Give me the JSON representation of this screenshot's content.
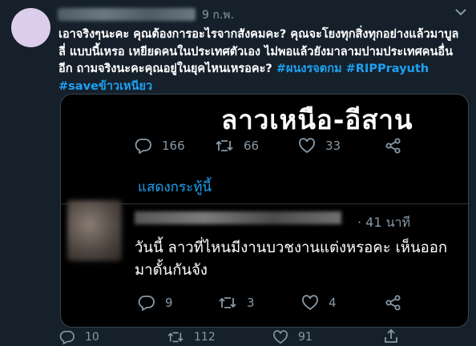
{
  "tweet": {
    "date": "9 ก.พ.",
    "text_plain": "เอาจริงๆนะคะ คุณต้องการอะไรจากสังคมคะ? คุณจะโยงทุกสิ่งทุกอย่างแล้วมาบูลลี่ แบบนี้เหรอ เหยียดคนในประเทศตัวเอง ไม่พอแล้วยังมาลามปามประเทศคนอื่นอีก ถามจริงนะคะคุณอยู่ในยุคไหนเหรอคะ?",
    "hashtag1": "#ผนงรจตกม",
    "hashtag2": "#RIPPrayuth",
    "hashtag3_bold": "#save",
    "hashtag3_rest": "ข้าวเหนียว",
    "stats": {
      "replies": "10",
      "retweets": "112",
      "likes": "91"
    }
  },
  "embedded": {
    "headline": "ลาวเหนือ-อีสาน",
    "stats": {
      "replies": "166",
      "retweets": "66",
      "likes": "33"
    },
    "show_thread": "แสดงกระทู้นี้",
    "reply": {
      "time": "· 41 นาที",
      "text": "วันนี้ ลาวที่ไหนมีงานบวชงานแต่งหรอคะ เห็นออกมาดั้นกันจัง",
      "stats": {
        "replies": "9",
        "retweets": "3",
        "likes": "4"
      }
    }
  },
  "icons": [
    "reply-icon",
    "retweet-icon",
    "like-icon",
    "share-icon",
    "chevron-down-icon"
  ],
  "colors": {
    "background": "#15202b",
    "link": "#1da1f2",
    "muted": "#8899a6",
    "card": "#000000"
  }
}
